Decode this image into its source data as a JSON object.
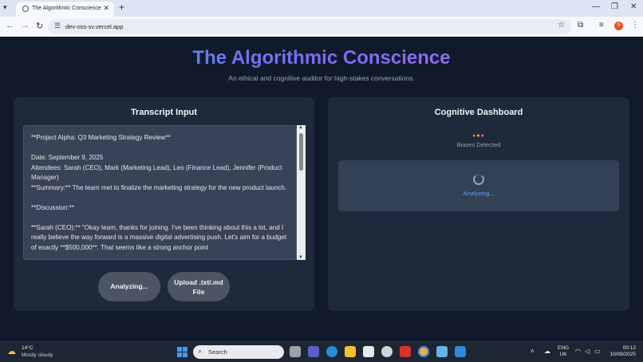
{
  "browser": {
    "tab_title": "The Algorithmic Conscience",
    "url": "dev-oss-sv.vercel.app",
    "profile_initial": "S"
  },
  "page": {
    "title": "The Algorithmic Conscience",
    "subtitle": "An ethical and cognitive auditor for high-stakes conversations."
  },
  "transcript": {
    "heading": "Transcript Input",
    "content": "**Project Alpha: Q3 Marketing Strategy Review**\n\nDate: September 9, 2025\nAttendees: Sarah (CEO), Mark (Marketing Lead), Leo (Finance Lead), Jennifer (Product Manager)\n**Summary:** The team met to finalize the marketing strategy for the new product launch.\n\n**Discussion:**\n\n**Sarah (CEO):** \"Okay team, thanks for joining. I've been thinking about this a lot, and I really believe the way forward is a massive digital advertising push. Let's aim for a budget of exactly **$500,000**. That seems like a strong anchor point",
    "analyze_button": "Analyzing...",
    "upload_button_line1": "Upload .txt/.md",
    "upload_button_line2": "File"
  },
  "dashboard": {
    "heading": "Cognitive Dashboard",
    "dots": "●●●",
    "biases_label": "Biases Detected",
    "status_text": "Analyzing..."
  },
  "colors": {
    "page_bg": "#101a2c",
    "panel_bg": "#1e293b",
    "accent_blue": "#60a5fa",
    "dot_colors": [
      "#f87171",
      "#fbbf24",
      "#f87171"
    ]
  },
  "taskbar": {
    "weather_temp": "14°C",
    "weather_desc": "Mostly cloudy",
    "search_placeholder": "Search",
    "lang_line1": "ENG",
    "lang_line2": "UK",
    "time": "00:12",
    "date": "10/09/2025"
  }
}
